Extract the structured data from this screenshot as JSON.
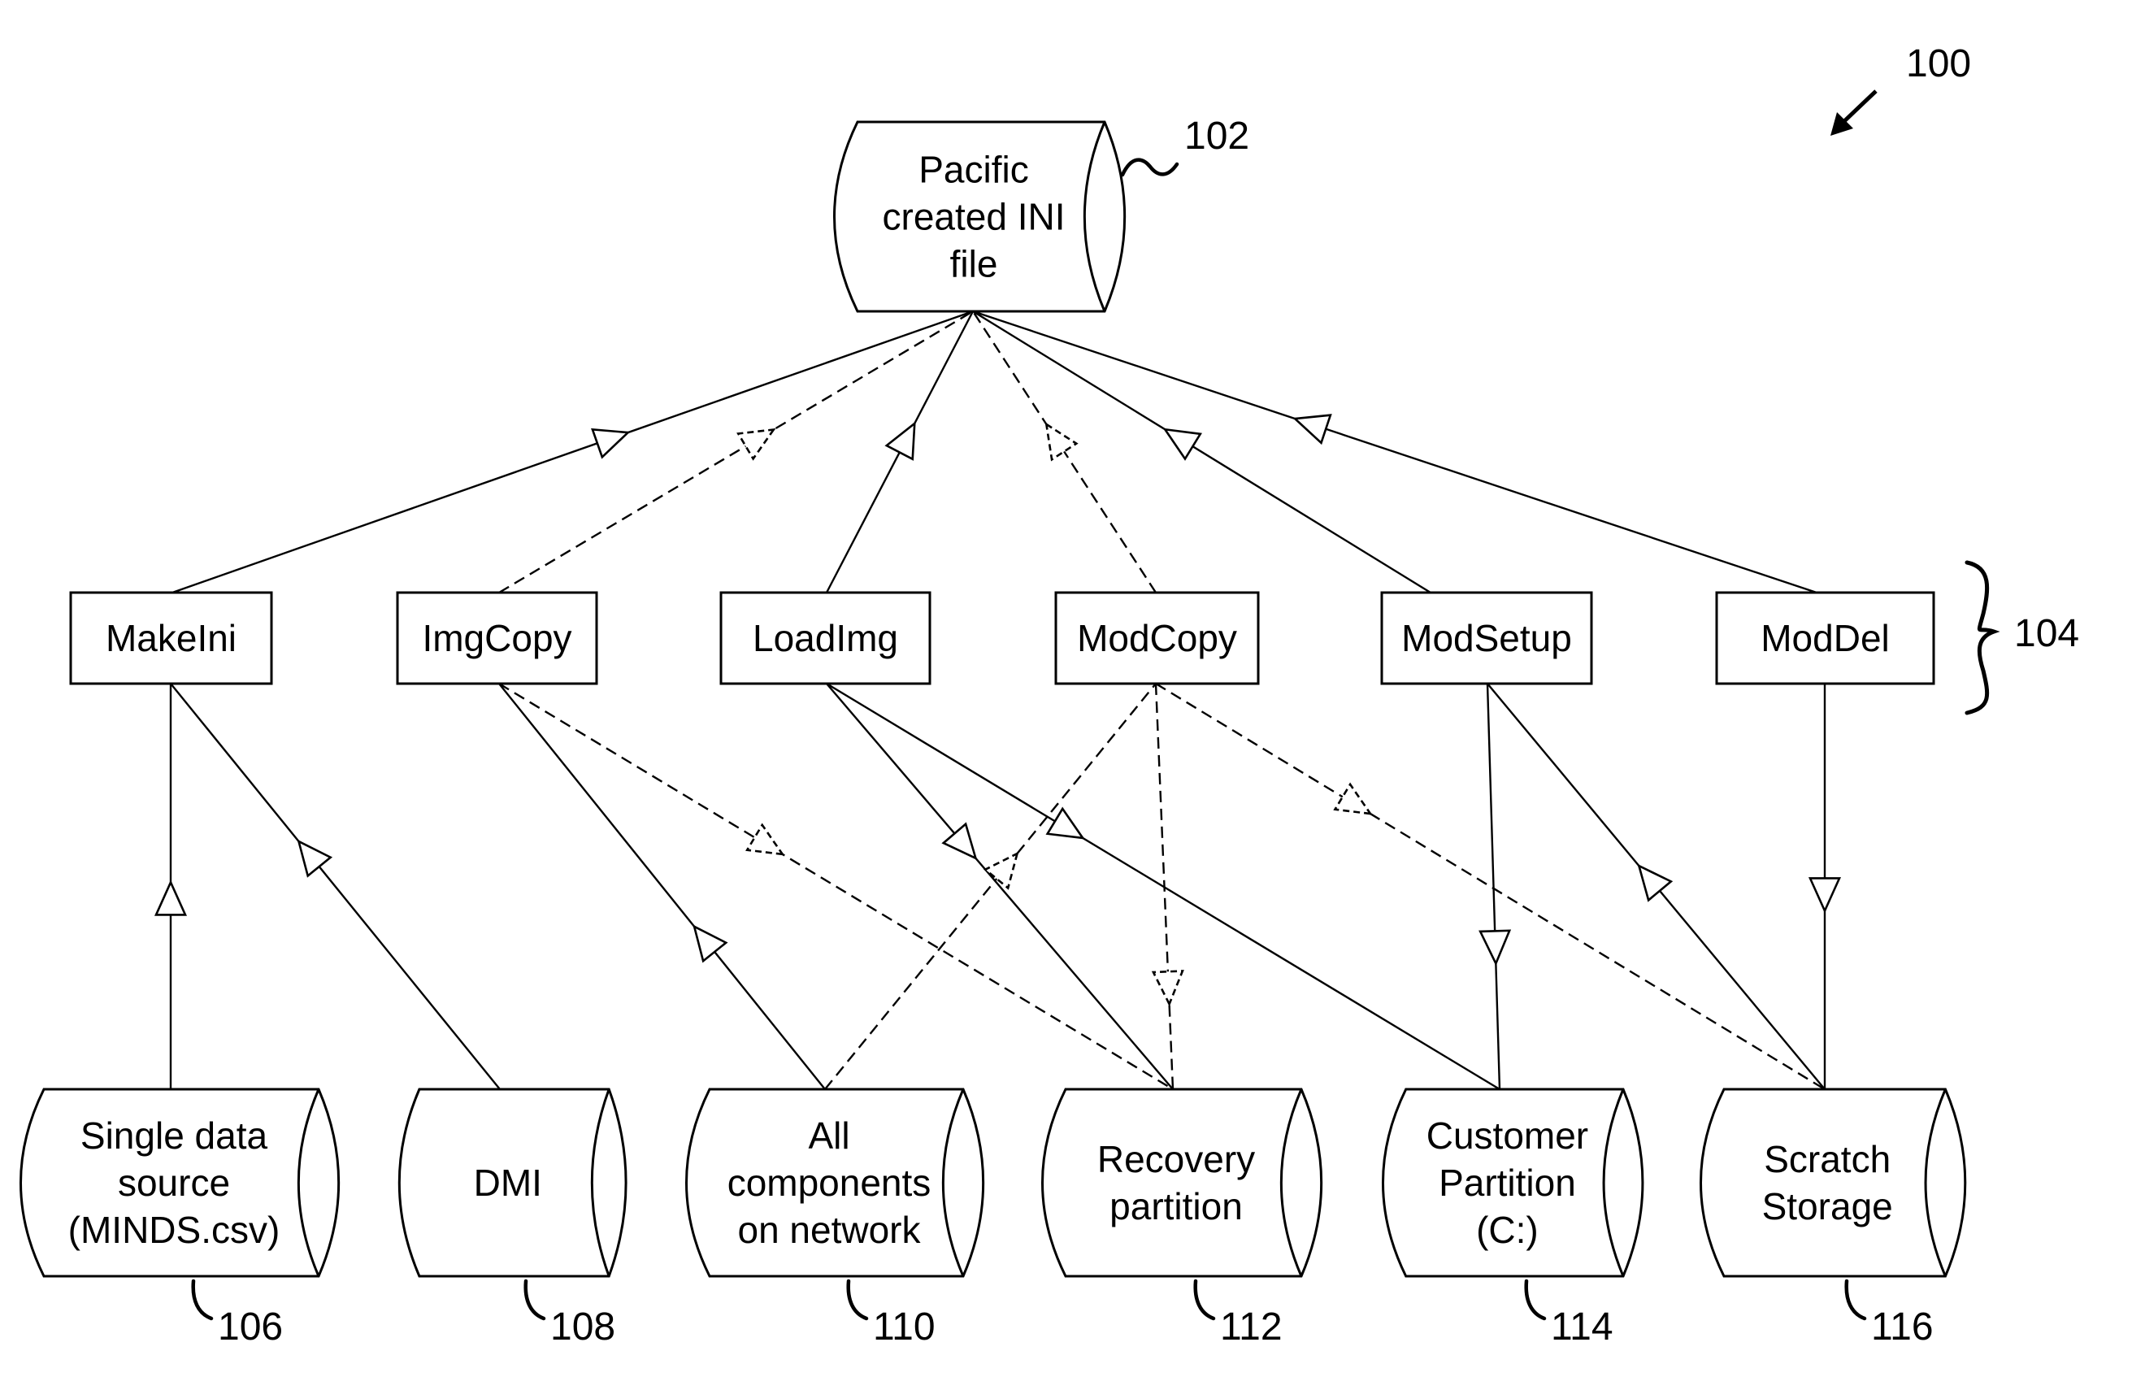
{
  "figure": {
    "reference": "100",
    "group_reference": "104"
  },
  "source_file": {
    "id": "ini",
    "ref": "102",
    "lines": [
      "Pacific",
      "created INI",
      "file"
    ]
  },
  "functions": [
    {
      "id": "makeini",
      "label": "MakeIni"
    },
    {
      "id": "imgcopy",
      "label": "ImgCopy"
    },
    {
      "id": "loadimg",
      "label": "LoadImg"
    },
    {
      "id": "modcopy",
      "label": "ModCopy"
    },
    {
      "id": "modsetup",
      "label": "ModSetup"
    },
    {
      "id": "moddel",
      "label": "ModDel"
    }
  ],
  "stores": [
    {
      "id": "minds",
      "ref": "106",
      "lines": [
        "Single data",
        "source",
        "(MINDS.csv)"
      ]
    },
    {
      "id": "dmi",
      "ref": "108",
      "lines": [
        "DMI"
      ]
    },
    {
      "id": "network",
      "ref": "110",
      "lines": [
        "All",
        "components",
        "on network"
      ]
    },
    {
      "id": "recovery",
      "ref": "112",
      "lines": [
        "Recovery",
        "partition"
      ]
    },
    {
      "id": "customer",
      "ref": "114",
      "lines": [
        "Customer",
        "Partition",
        "(C:)"
      ]
    },
    {
      "id": "scratch",
      "ref": "116",
      "lines": [
        "Scratch",
        "Storage"
      ]
    }
  ],
  "edges": [
    {
      "from": "makeini",
      "to": "ini",
      "style": "solid"
    },
    {
      "from": "imgcopy",
      "to": "ini",
      "style": "dashed"
    },
    {
      "from": "loadimg",
      "to": "ini",
      "style": "solid"
    },
    {
      "from": "modcopy",
      "to": "ini",
      "style": "dashed"
    },
    {
      "from": "modsetup",
      "to": "ini",
      "style": "solid"
    },
    {
      "from": "moddel",
      "to": "ini",
      "style": "solid"
    },
    {
      "from": "minds",
      "to": "makeini",
      "style": "solid"
    },
    {
      "from": "dmi",
      "to": "makeini",
      "style": "solid"
    },
    {
      "from": "network",
      "to": "imgcopy",
      "style": "solid"
    },
    {
      "from": "imgcopy",
      "to": "recovery",
      "style": "dashed"
    },
    {
      "from": "loadimg",
      "to": "recovery",
      "style": "solid"
    },
    {
      "from": "loadimg",
      "to": "customer",
      "style": "solid"
    },
    {
      "from": "network",
      "to": "modcopy",
      "style": "dashed"
    },
    {
      "from": "modcopy",
      "to": "recovery",
      "style": "dashed"
    },
    {
      "from": "modcopy",
      "to": "scratch",
      "style": "dashed"
    },
    {
      "from": "modsetup",
      "to": "customer",
      "style": "solid"
    },
    {
      "from": "scratch",
      "to": "modsetup",
      "style": "solid"
    },
    {
      "from": "moddel",
      "to": "scratch",
      "style": "solid"
    }
  ]
}
